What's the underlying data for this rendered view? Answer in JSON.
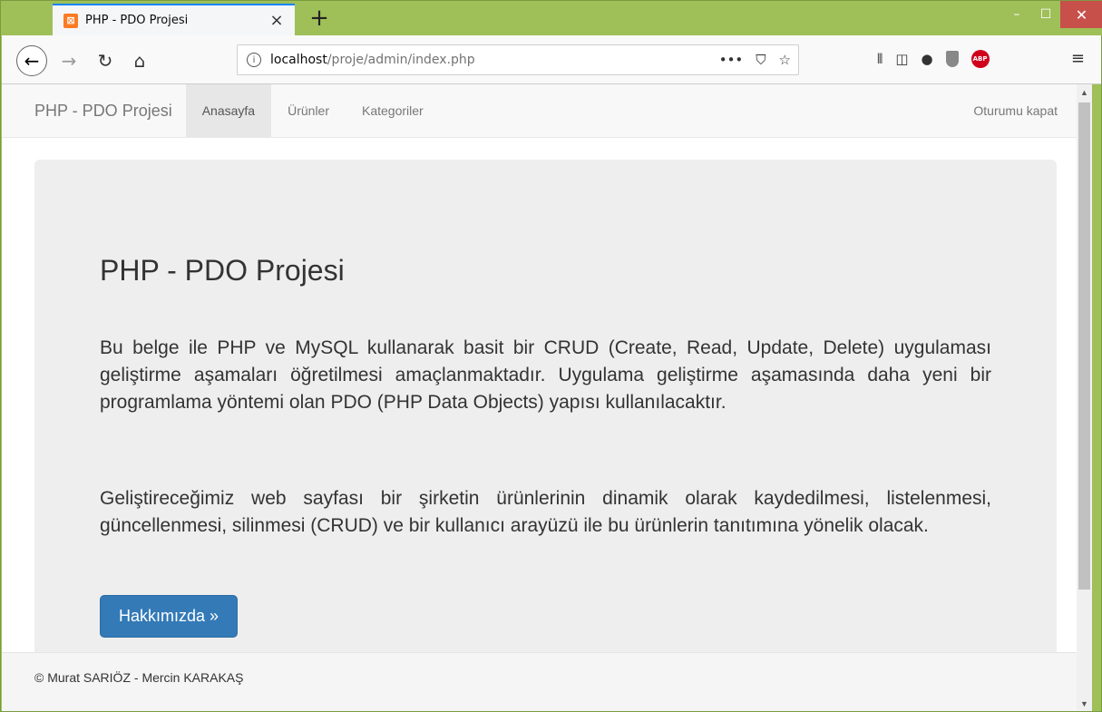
{
  "browser": {
    "tab_title": "PHP - PDO Projesi",
    "tab_favicon": "xampp-icon",
    "url_host": "localhost",
    "url_path": "/proje/admin/index.php"
  },
  "site": {
    "brand": "PHP - PDO Projesi",
    "nav": [
      "Anasayfa",
      "Ürünler",
      "Kategoriler"
    ],
    "active_nav": "Anasayfa",
    "logout": "Oturumu kapat"
  },
  "jumbotron": {
    "title": "PHP - PDO Projesi",
    "paragraph1": "Bu belge ile PHP ve MySQL kullanarak basit bir CRUD (Create, Read, Update, Delete) uygulaması geliştirme aşamaları öğretilmesi amaçlanmaktadır. Uygulama geliştirme aşamasında daha yeni bir programlama yöntemi olan PDO (PHP Data Objects) yapısı kullanılacaktır.",
    "paragraph2": "Geliştireceğimiz web sayfası bir şirketin ürünlerinin dinamik olarak kaydedilmesi, listelenmesi, güncellenmesi, silinmesi (CRUD) ve bir kullanıcı arayüzü ile bu ürünlerin tanıtımına yönelik olacak.",
    "button": "Hakkımızda »"
  },
  "footer": {
    "text": "© Murat SARIÖZ - Mercin KARAKAŞ"
  },
  "colors": {
    "window_frame": "#9fbf58",
    "tab_accent": "#0a84ff",
    "primary_button": "#337ab7",
    "jumbotron_bg": "#eeeeee"
  }
}
